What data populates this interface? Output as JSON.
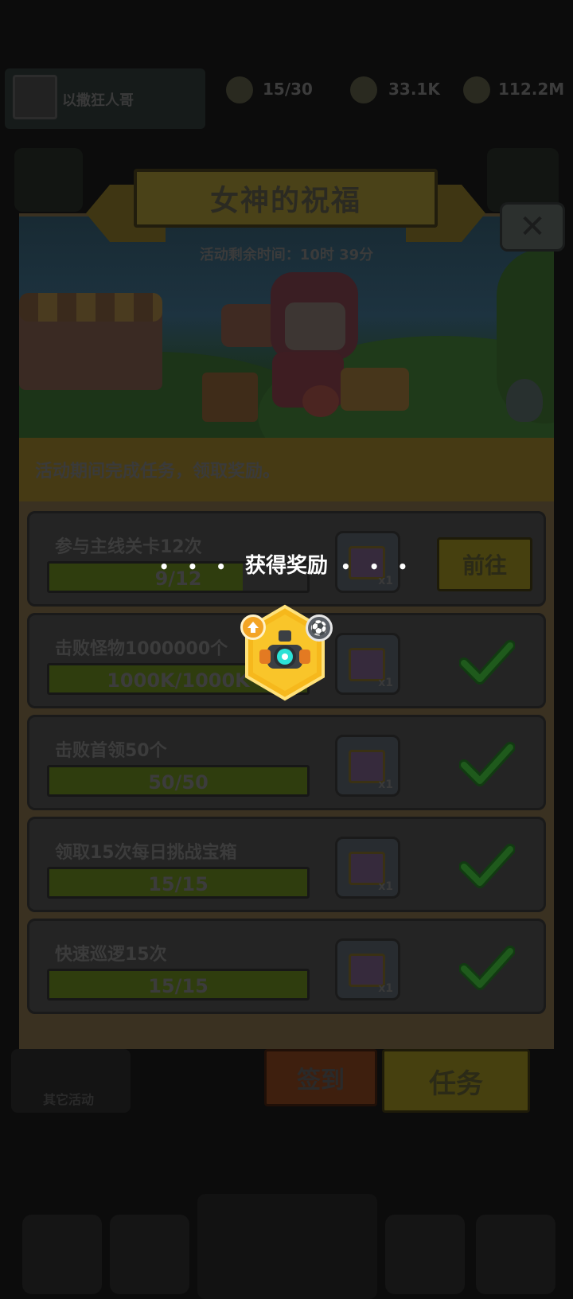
{
  "hud": {
    "player_name": "以撒狂人哥",
    "stamina": "15/30",
    "gems": "33.1K",
    "coins": "112.2M"
  },
  "event": {
    "title": "女神的祝福",
    "timer": "活动剩余时间：10时 39分",
    "description": "活动期间完成任务，领取奖励。"
  },
  "tasks": [
    {
      "name": "参与主线关卡12次",
      "progress": "9/12",
      "fraction": 0.75,
      "reward_qty": "x1",
      "status": "goto",
      "action_label": "前往"
    },
    {
      "name": "击败怪物1000000个",
      "progress": "1000K/1000K",
      "fraction": 1.0,
      "reward_qty": "x1",
      "status": "done"
    },
    {
      "name": "击败首领50个",
      "progress": "50/50",
      "fraction": 1.0,
      "reward_qty": "x1",
      "status": "done"
    },
    {
      "name": "领取15次每日挑战宝箱",
      "progress": "15/15",
      "fraction": 1.0,
      "reward_qty": "x1",
      "status": "done"
    },
    {
      "name": "快速巡逻15次",
      "progress": "15/15",
      "fraction": 1.0,
      "reward_qty": "x1",
      "status": "done"
    }
  ],
  "tabs": {
    "signin": "签到",
    "tasks": "任务",
    "left_label": "其它活动"
  },
  "reward_popup": {
    "title": "获得奖励",
    "dots_left": "• • •",
    "dots_right": "• • •",
    "item_icon": "hex-gear-equipment-icon",
    "rarity_color": "#f6b81c",
    "badge_left_icon": "upgrade-icon",
    "badge_right_icon": "soccer-ball-icon"
  }
}
